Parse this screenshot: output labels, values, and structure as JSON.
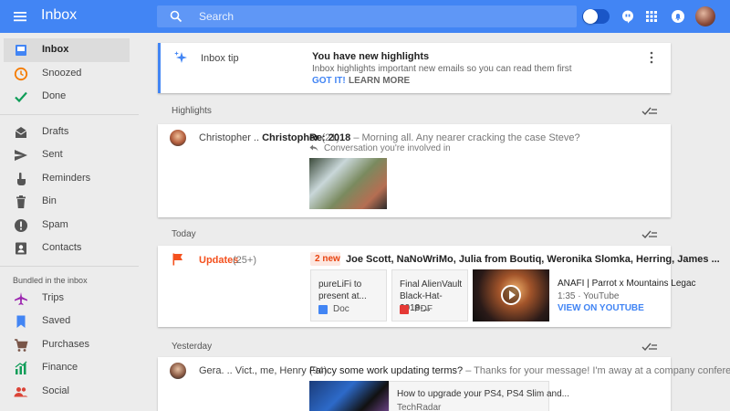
{
  "app": {
    "title": "Inbox"
  },
  "search": {
    "placeholder": "Search"
  },
  "colors": {
    "brand": "#4285f4",
    "updates": "#f4511e",
    "snoozed": "#f57c00",
    "done": "#0f9d58"
  },
  "sidebar": {
    "items": [
      {
        "label": "Inbox",
        "icon": "inbox-icon",
        "active": true
      },
      {
        "label": "Snoozed",
        "icon": "clock-icon"
      },
      {
        "label": "Done",
        "icon": "check-icon"
      },
      {
        "label": "Drafts",
        "icon": "drafts-icon"
      },
      {
        "label": "Sent",
        "icon": "send-icon"
      },
      {
        "label": "Reminders",
        "icon": "reminder-hand-icon"
      },
      {
        "label": "Bin",
        "icon": "trash-icon"
      },
      {
        "label": "Spam",
        "icon": "spam-icon"
      },
      {
        "label": "Contacts",
        "icon": "contacts-icon"
      }
    ],
    "bundled_heading": "Bundled in the inbox",
    "bundles": [
      {
        "label": "Trips",
        "icon": "plane-icon"
      },
      {
        "label": "Saved",
        "icon": "bookmark-icon"
      },
      {
        "label": "Purchases",
        "icon": "cart-icon"
      },
      {
        "label": "Finance",
        "icon": "chart-icon"
      },
      {
        "label": "Social",
        "icon": "people-icon"
      }
    ]
  },
  "tip": {
    "label": "Inbox tip",
    "title": "You have new highlights",
    "description": "Inbox highlights important new emails so you can read them first",
    "got_it": "GOT IT!",
    "learn_more": "LEARN MORE"
  },
  "sections": {
    "highlights": "Highlights",
    "today": "Today",
    "yesterday": "Yesterday"
  },
  "highlight_email": {
    "sender_first": "Christopher ..",
    "sender_second": "Christopher",
    "count": "(21)",
    "subject": "Re: 2018",
    "snippet": " – Morning all. Any nearer cracking the case Steve?",
    "conversation": "Conversation you're involved in"
  },
  "updates_bundle": {
    "label": "Updates",
    "count": "(25+)",
    "new_badge": "2 new",
    "senders": "Joe Scott, NaNoWriMo, Julia from Boutiq, Weronika Slomka, Herring, James ...",
    "attachments": [
      {
        "name": "pureLiFi to present at...",
        "type": "Doc"
      },
      {
        "name": "Final AlienVault Black-Hat-2018-...",
        "type": "PDF"
      }
    ],
    "video": {
      "title": "ANAFI | Parrot x Mountains Legac",
      "meta": "1:35 · YouTube",
      "link": "VIEW ON YOUTUBE"
    }
  },
  "yesterday_email": {
    "senders": "Gera. .. Vict., me, Henry",
    "count": "(94)",
    "subject": "Fancy some work updating terms?",
    "snippet": " – Thanks for your message! I'm away at a company conference fo",
    "preview_title": "How to upgrade your PS4, PS4 Slim and...",
    "preview_source": "TechRadar"
  }
}
